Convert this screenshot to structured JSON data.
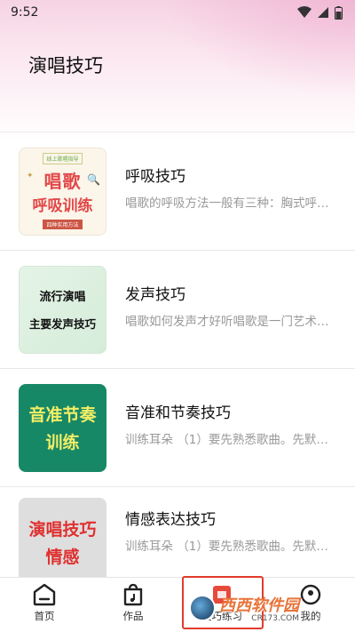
{
  "status_bar": {
    "time": "9:52"
  },
  "page": {
    "title": "演唱技巧"
  },
  "items": [
    {
      "title": "呼吸技巧",
      "desc": "唱歌的呼吸方法一般有三种：胸式呼…",
      "thumb": {
        "tag": "线上歌唱指导",
        "line1": "唱歌",
        "line2": "呼吸训练",
        "sub": "四种实用方法"
      }
    },
    {
      "title": "发声技巧",
      "desc": "唱歌如何发声才好听唱歌是一门艺术…",
      "thumb": {
        "line1": "流行演唱",
        "line2": "主要发声技巧"
      }
    },
    {
      "title": "音准和节奏技巧",
      "desc": "训练耳朵 （1）要先熟悉歌曲。先默…",
      "thumb": {
        "line1": "音准节奏",
        "line2": "训练"
      }
    },
    {
      "title": "情感表达技巧",
      "desc": "训练耳朵 （1）要先熟悉歌曲。先默…",
      "thumb": {
        "line1": "演唱技巧",
        "line2": "情感"
      }
    }
  ],
  "bottom_nav": [
    {
      "label": "首页",
      "icon": "home-icon"
    },
    {
      "label": "作品",
      "icon": "music-bag-icon"
    },
    {
      "label": "技巧练习",
      "icon": "practice-icon",
      "active": true
    },
    {
      "label": "我的",
      "icon": "profile-icon"
    }
  ],
  "watermark": {
    "main": "西西软件园",
    "sub": "CR173.COM"
  },
  "colors": {
    "accent": "#e13b2b",
    "header_pink": "#f6d3e3"
  }
}
